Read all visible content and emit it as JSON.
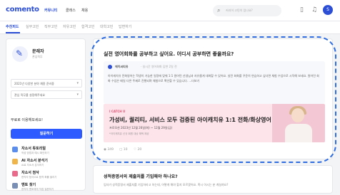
{
  "brand": {
    "logo": "comento",
    "accent": "#2d4fd6"
  },
  "gnb": [
    "커뮤니티",
    "클래스",
    "채용"
  ],
  "search": {
    "placeholder": "커리어 고민이 있나요?"
  },
  "topbar_icons": [
    "document-icon",
    "bell-icon"
  ],
  "user_avatar_text": "S",
  "tabs": [
    {
      "label": "추천피드",
      "active": true
    },
    {
      "label": "실무고민"
    },
    {
      "label": "직무고민"
    },
    {
      "label": "자유고민"
    },
    {
      "label": "합격고민"
    },
    {
      "label": "대학고민"
    },
    {
      "label": "답변하기"
    }
  ],
  "sidebar": {
    "profile_name": "문래자",
    "profile_sub": "관심직무",
    "selects": [
      "2021년 다양한 분야 채용 준비중",
      "관심 직무를 설정해주세요"
    ],
    "plain": "무료로 이용해보세요!",
    "question_button": "질문하기",
    "menu": [
      {
        "title": "자소서 튜토리얼",
        "sub": "작성 방법과 예시 확인하기",
        "color": "#5b8def"
      },
      {
        "title": "AI 자소서 분석기",
        "sub": "AI로 자소서 분석하기",
        "color": "#f0b54a"
      },
      {
        "title": "자소서 첨삭",
        "sub": "현직자 첨삭으로 합격 확률 올리기",
        "color": "#e96a8a"
      },
      {
        "title": "멘토 찾기",
        "sub": "현직자 멘토에게 직접 질문하기",
        "color": "#7a8fb5"
      }
    ]
  },
  "post": {
    "title": "실전 영어회화를 공부하고 싶어요. 어디서 공부하면 좋을까요?",
    "answer_name": "에이씨티유",
    "answer_meta": "· 실시간 영어회화 답변 2일 전",
    "answer_text": "아이캐치유 전화영어는 학생이 가능한 일정에 맞춰 1:1 원어민 선생님과 자유롭게 대화할 수 있어요. 실전 회화를 꾸준히 연습하고 싶다면 체험 수업으로 시작해 보세요. 원어민 회화 수업은 매일 다른 주제로 진행되며 체험으로 확인할 수 있습니다. ...더보기",
    "banner": {
      "brand": "I CATCH U",
      "headline": "가성비, 퀄리티, 서비스 모두 검증된 아이캐치유 1:1 전화/화상영어",
      "date": "프로모션 2023년 12월 26일(화) ~ 12월 29일(금)",
      "note": "*아이캐치유 신규 회원 대상 혜택 제공"
    },
    "stats": {
      "views": "349",
      "comments": "10",
      "likes": "20"
    }
  },
  "post2": {
    "title": "성적증명서의 제출처를 기입해야 하나요?",
    "text": "입자가 성적증명서 제출처를 기입하라고 하는데, 어떻게 해야 할지 모르겠어요. 혹시 아시는 분 계실까요?"
  }
}
